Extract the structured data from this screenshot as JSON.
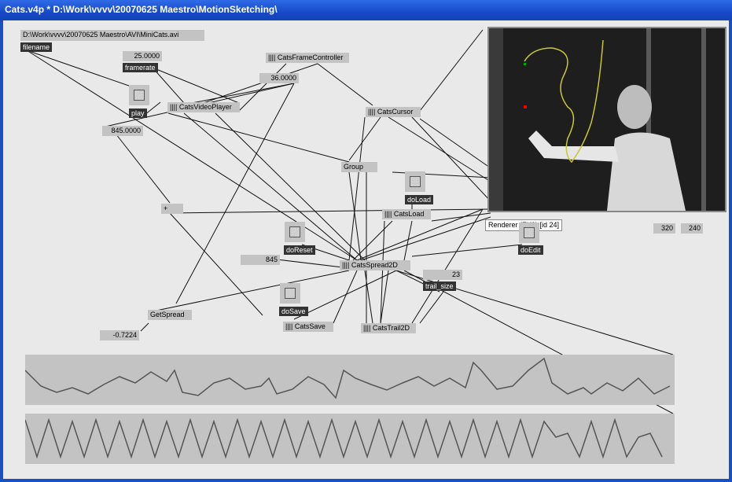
{
  "window": {
    "title": "Cats.v4p *  D:\\Work\\vvvv\\20070625 Maestro\\MotionSketching\\"
  },
  "nodes": {
    "filepath": "D:\\Work\\vvvv\\20070625 Maestro\\AVI\\MiniCats.avi",
    "filename_label": "filename",
    "framerate_value": "25.0000",
    "framerate_label": "framerate",
    "frame_controller": "|||| CatsFrameController",
    "frame_controller_value": "36.0000",
    "video_player": "|||| CatsVideoPlayer",
    "play_label": "play",
    "position_value": "845.0000",
    "cursor": "|||| CatsCursor",
    "group": "Group",
    "do_load_label": "doLoad",
    "cats_load": "|||| CatsLoad",
    "plus": "+",
    "renderer_tooltip": "Renderer (EX9) [id 24]",
    "width_value": "320",
    "height_value": "240",
    "do_edit_label": "doEdit",
    "do_reset_label": "doReset",
    "count_value": "845",
    "spread2d": "|||| CatsSpread2D",
    "trail_size_value": "23",
    "trail_size_label": "trail_size",
    "do_save_label": "doSave",
    "get_spread": "GetSpread",
    "cats_save": "|||| CatsSave",
    "cats_trail": "|||| CatsTrail2D",
    "spread_value": "-0.7224"
  }
}
